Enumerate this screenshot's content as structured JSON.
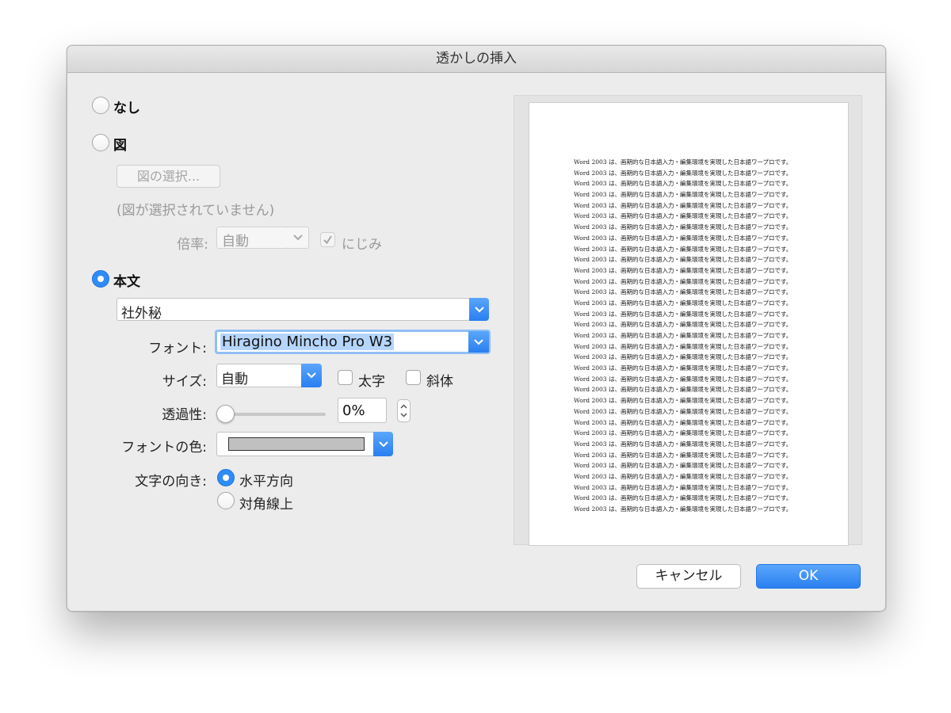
{
  "dialog": {
    "title": "透かしの挿入"
  },
  "options": {
    "none_label": "なし",
    "picture_label": "図",
    "text_label": "本文",
    "selected": "text"
  },
  "picture": {
    "select_button": "図の選択...",
    "status": "(図が選択されていません)",
    "scale_label": "倍率:",
    "scale_value": "自動",
    "washout_label": "にじみ",
    "washout_checked": true
  },
  "text": {
    "text_value": "社外秘",
    "font_label": "フォント:",
    "font_value": "Hiragino Mincho Pro W3",
    "size_label": "サイズ:",
    "size_value": "自動",
    "bold_label": "太字",
    "bold_checked": false,
    "italic_label": "斜体",
    "italic_checked": false,
    "transparency_label": "透過性:",
    "transparency_value": "0%",
    "transparency_level": 0,
    "color_label": "フォントの色:",
    "color_value": "#c0c0c0",
    "orientation_label": "文字の向き:",
    "orientation_horizontal": "水平方向",
    "orientation_diagonal": "対角線上",
    "orientation_selected": "horizontal"
  },
  "preview": {
    "line_text": "Word 2003 は、画期的な日本語入力・編集環境を実現した日本語ワープロです。",
    "line_count": 33
  },
  "buttons": {
    "cancel": "キャンセル",
    "ok": "OK"
  },
  "colors": {
    "accent": "#2f8cf6",
    "dialog_bg": "#ececec"
  }
}
